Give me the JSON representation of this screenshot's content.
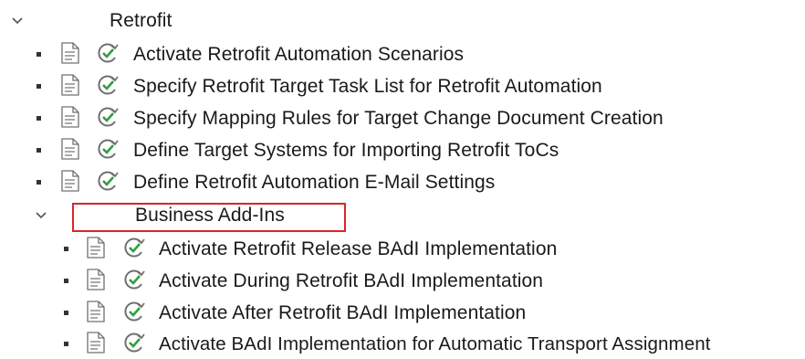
{
  "tree": {
    "retrofit_node": {
      "label": "Retrofit",
      "expanded": true
    },
    "retrofit_items": [
      {
        "label": "Activate Retrofit Automation Scenarios"
      },
      {
        "label": "Specify Retrofit Target Task List for Retrofit Automation"
      },
      {
        "label": "Specify Mapping Rules for Target Change Document Creation"
      },
      {
        "label": "Define Target Systems for Importing Retrofit ToCs"
      },
      {
        "label": "Define Retrofit Automation E-Mail Settings"
      }
    ],
    "badi_node": {
      "label": "Business Add-Ins",
      "expanded": true,
      "highlight_color": "#d9252b"
    },
    "badi_items": [
      {
        "label": "Activate Retrofit Release BAdI Implementation"
      },
      {
        "label": "Activate During Retrofit BAdI Implementation"
      },
      {
        "label": "Activate After Retrofit BAdI Implementation"
      },
      {
        "label": "Activate BAdI Implementation for Automatic Transport Assignment"
      }
    ]
  },
  "colors": {
    "highlight_box": "#d9252b",
    "exec_icon_check": "#2f9e3e",
    "icon_gray": "#707070"
  },
  "icons": {
    "chevron": "chevron-down-icon",
    "document": "document-icon",
    "execute": "execute-icon"
  }
}
